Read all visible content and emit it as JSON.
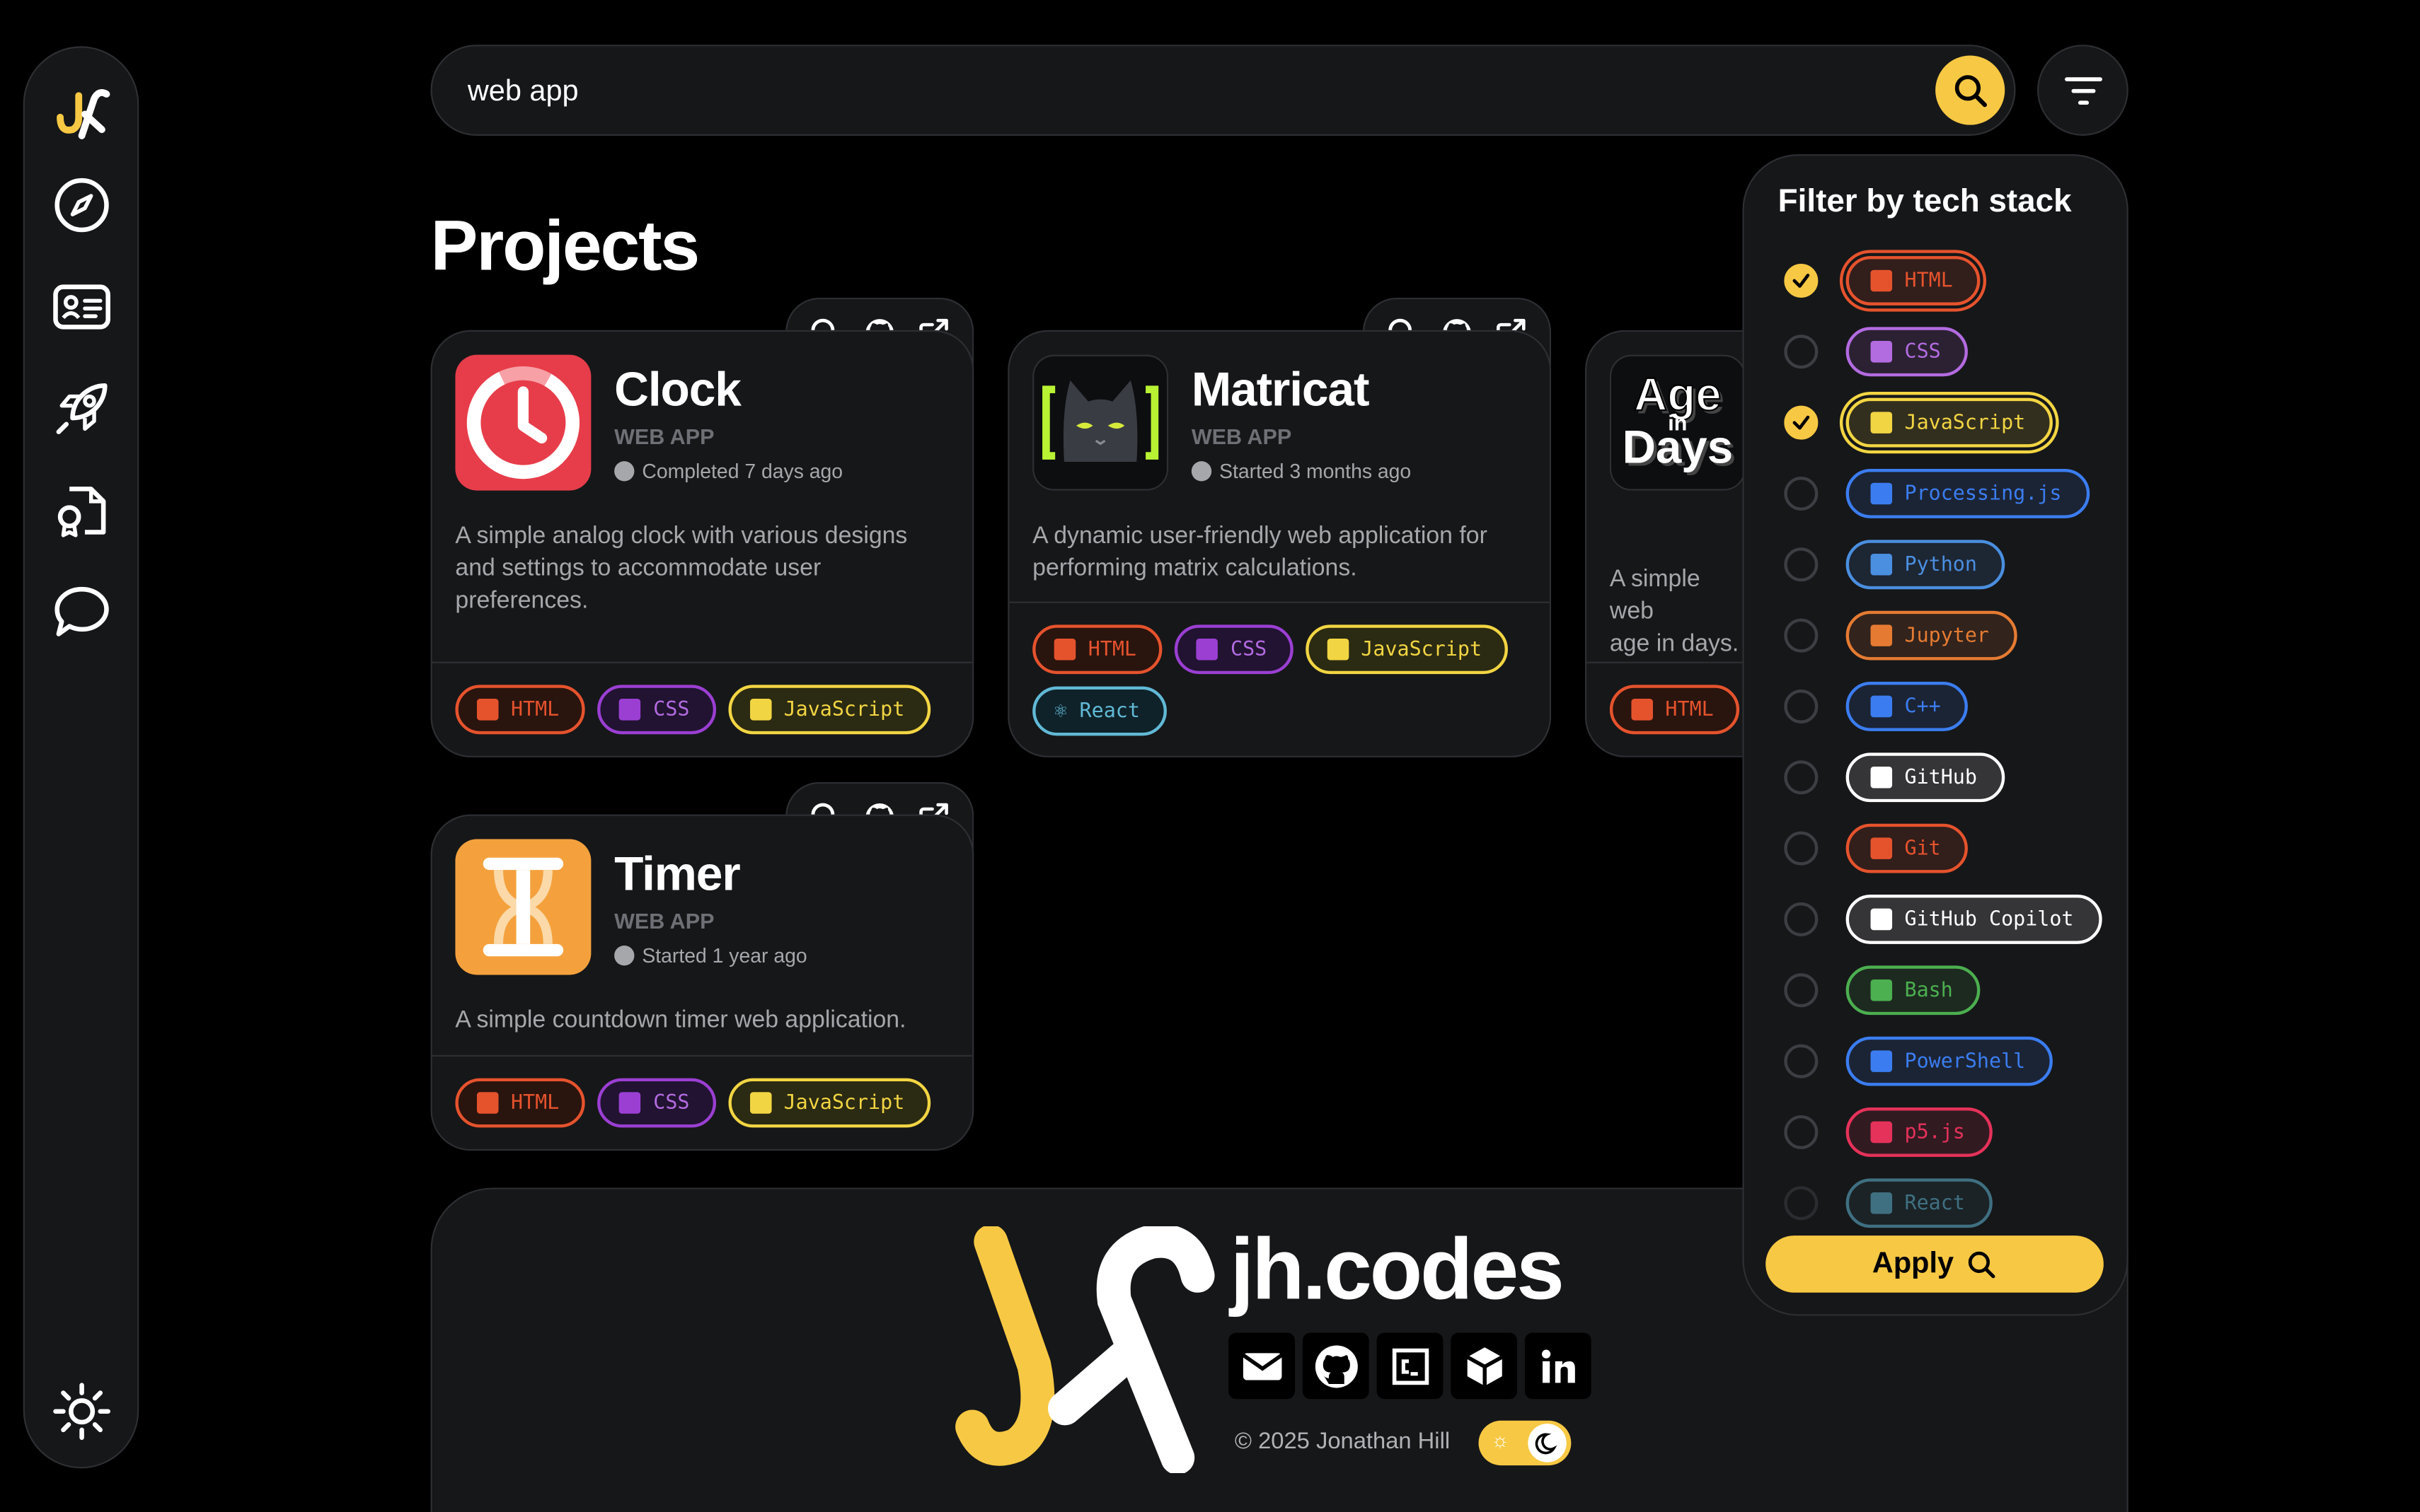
{
  "search": {
    "query": "web app"
  },
  "page": {
    "title": "Projects"
  },
  "colors": {
    "accent": "#f7c843",
    "background": "#000000",
    "surface": "#161719",
    "html": "#e5532d",
    "css": "#9b3fd3",
    "javascript": "#f2d543",
    "react": "#61b9d6"
  },
  "sidebar": {
    "items": [
      {
        "icon": "compass-icon"
      },
      {
        "icon": "id-card-icon"
      },
      {
        "icon": "rocket-icon"
      },
      {
        "icon": "certificate-file-icon"
      },
      {
        "icon": "chat-bubble-icon"
      }
    ],
    "theme_icon": "sun-icon"
  },
  "projects": [
    {
      "name": "Clock",
      "kind": "WEB APP",
      "status": "Completed 7 days ago",
      "description": "A simple analog clock with various designs and settings to accommodate user preferences.",
      "tags": [
        "HTML",
        "CSS",
        "JavaScript"
      ]
    },
    {
      "name": "Matricat",
      "kind": "WEB APP",
      "status": "Started 3 months ago",
      "description": "A dynamic user-friendly web application for performing matrix calculations.",
      "tags": [
        "HTML",
        "CSS",
        "JavaScript",
        "React"
      ]
    },
    {
      "name": "Age in Days",
      "thumb_text": [
        "Age",
        "in",
        "Days"
      ],
      "description": "A simple web app that calculates your age in days.",
      "description_visible": "A simple web",
      "description_visible_2": "age in days.",
      "tags": [
        "HTML"
      ]
    },
    {
      "name": "Timer",
      "kind": "WEB APP",
      "status": "Started 1 year ago",
      "description": "A simple countdown timer web application.",
      "tags": [
        "HTML",
        "CSS",
        "JavaScript"
      ]
    }
  ],
  "filter": {
    "title": "Filter by tech stack",
    "options": [
      {
        "label": "HTML",
        "checked": true,
        "color": "#e5532d"
      },
      {
        "label": "CSS",
        "checked": false,
        "color": "#b36be0"
      },
      {
        "label": "JavaScript",
        "checked": true,
        "color": "#f2d543"
      },
      {
        "label": "Processing.js",
        "checked": false,
        "color": "#3b7df0"
      },
      {
        "label": "Python",
        "checked": false,
        "color": "#4a8fe0"
      },
      {
        "label": "Jupyter",
        "checked": false,
        "color": "#e57b32"
      },
      {
        "label": "C++",
        "checked": false,
        "color": "#3b7df0"
      },
      {
        "label": "GitHub",
        "checked": false,
        "color": "#ffffff"
      },
      {
        "label": "Git",
        "checked": false,
        "color": "#e5532d"
      },
      {
        "label": "GitHub Copilot",
        "checked": false,
        "color": "#ffffff"
      },
      {
        "label": "Bash",
        "checked": false,
        "color": "#4caf50"
      },
      {
        "label": "PowerShell",
        "checked": false,
        "color": "#3b7df0"
      },
      {
        "label": "p5.js",
        "checked": false,
        "color": "#e5325a"
      },
      {
        "label": "React",
        "checked": false,
        "color": "#61b9d6"
      }
    ],
    "apply_label": "Apply"
  },
  "footer": {
    "brand": "jh.codes",
    "copyright": "© 2025 Jonathan Hill",
    "socials": [
      "email-icon",
      "github-icon",
      "codepen-icon",
      "codesandbox-icon",
      "linkedin-icon"
    ]
  }
}
